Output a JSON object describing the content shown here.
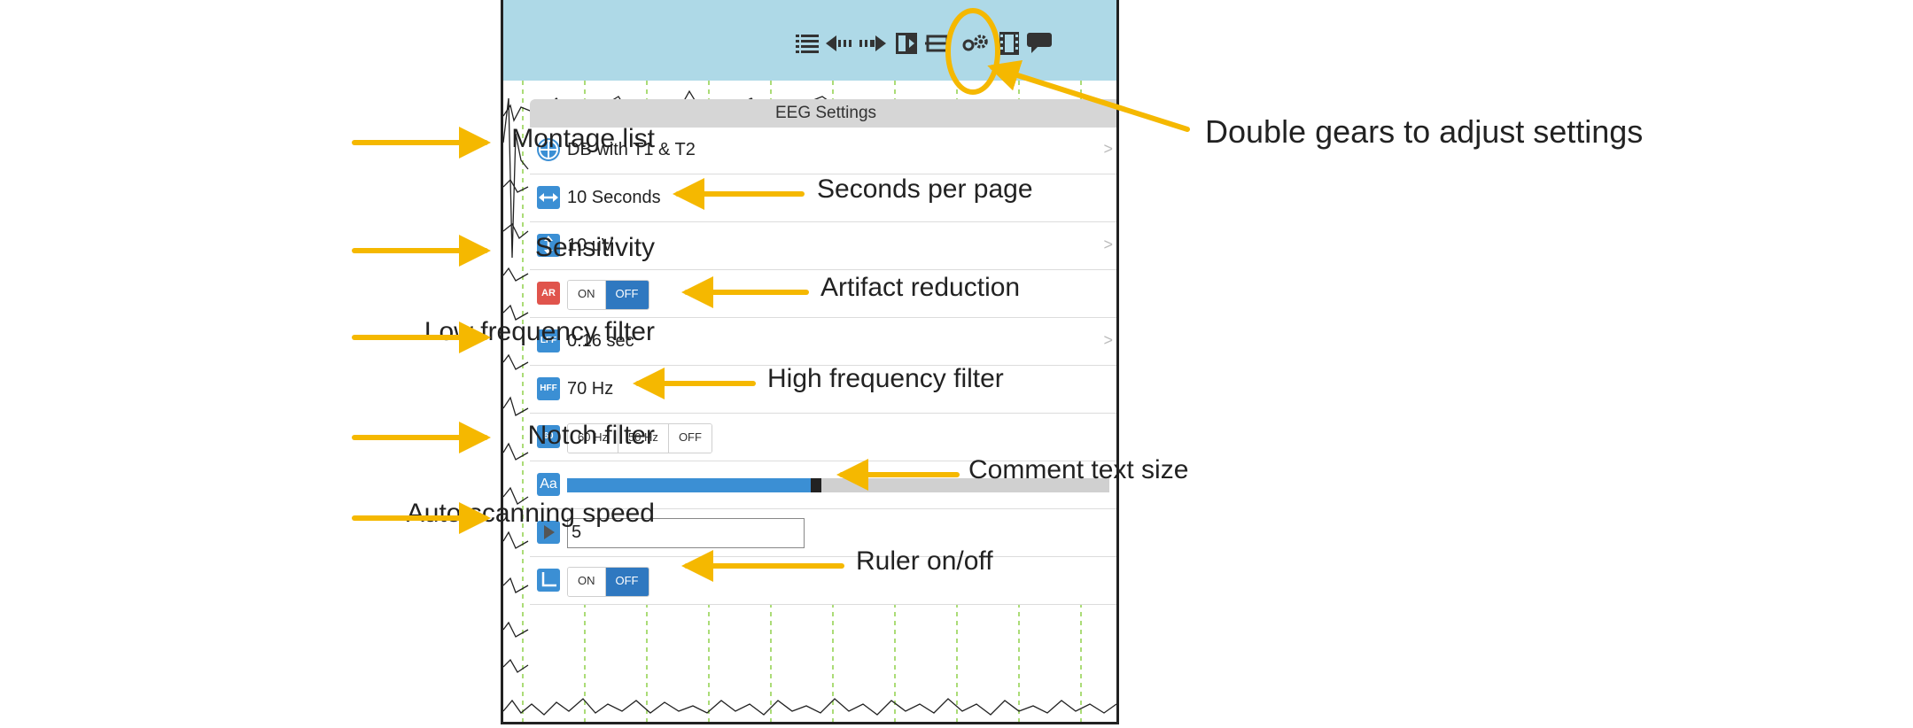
{
  "panel": {
    "title": "EEG Settings",
    "montage": "DB with T1 & T2",
    "seconds": "10 Seconds",
    "sensitivity": "10 uV",
    "artifact_icon": "AR",
    "artifact_on": "ON",
    "artifact_off": "OFF",
    "lff_icon": "LFF",
    "lff_value": "0.16 sec",
    "hff_icon": "HFF",
    "hff_value": "70 Hz",
    "notch_icon": "60",
    "notch_options": [
      "60 Hz",
      "50 Hz",
      "OFF"
    ],
    "textsize_icon": "Aa",
    "textsize_level": 0.45,
    "scan_value": "5",
    "ruler_on": "ON",
    "ruler_off": "OFF",
    "chevron": ">"
  },
  "labels": {
    "montage_list": "Montage list",
    "sensitivity": "Sensitivity",
    "low_freq": "Low frequency filter",
    "notch": "Notch filter",
    "auto_scan": "Auto scanning speed",
    "double_gears": "Double gears to adjust settings",
    "seconds_per_page": "Seconds per page",
    "artifact_reduction": "Artifact reduction",
    "high_freq": "High frequency filter",
    "comment_text_size": "Comment text size",
    "ruler": "Ruler on/off"
  },
  "icons": [
    "list-icon",
    "arrow-left-icon",
    "arrow-right-icon",
    "panel-icon",
    "ruler-icon",
    "double-gears-icon",
    "film-icon",
    "comment-icon",
    "globe-icon",
    "horizontal-arrows-icon",
    "vertical-arrows-icon",
    "play-icon"
  ],
  "colors": {
    "topbar": "#aed9e7",
    "accent": "#3b8fd4",
    "arrow": "#f5b800",
    "active_toggle": "#2f78c0",
    "artifact_icon": "#e0544c"
  }
}
